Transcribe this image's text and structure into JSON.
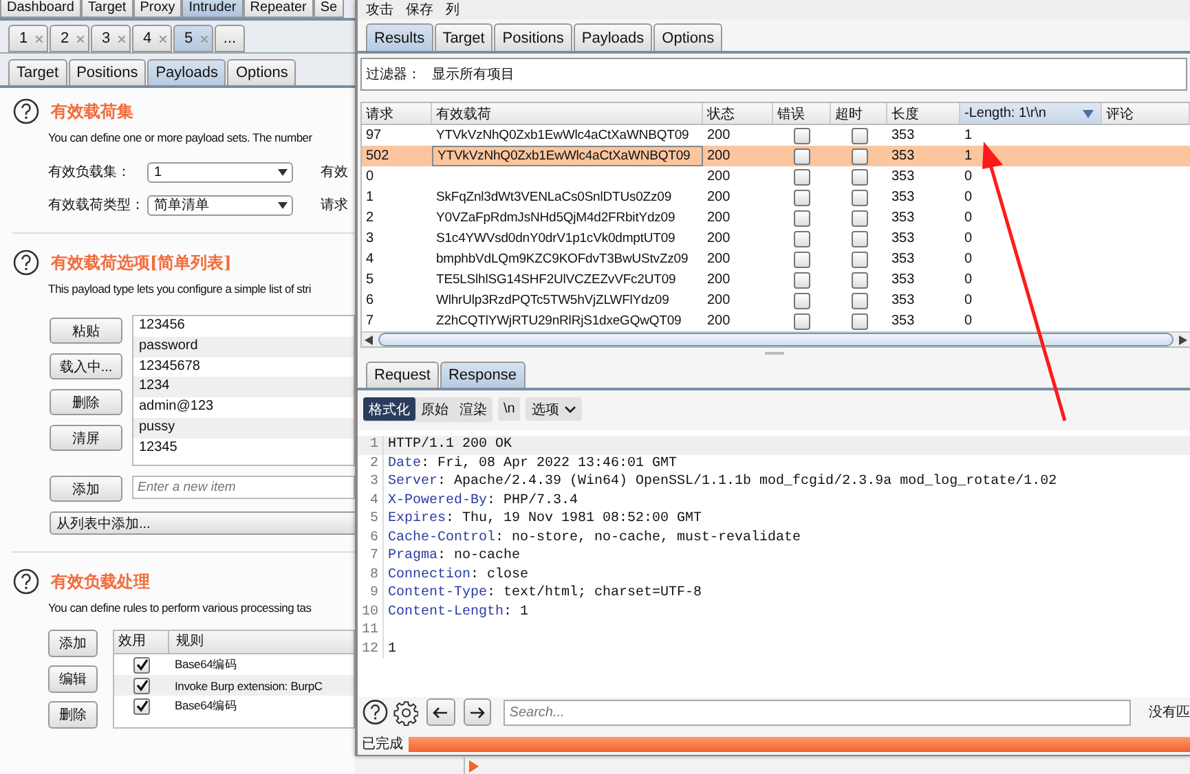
{
  "main_window": {
    "top_tabs": [
      {
        "label": "Dashboard",
        "selected": false
      },
      {
        "label": "Target",
        "selected": false
      },
      {
        "label": "Proxy",
        "selected": false
      },
      {
        "label": "Intruder",
        "selected": true
      },
      {
        "label": "Repeater",
        "selected": false
      },
      {
        "label": "Se",
        "selected": false
      }
    ],
    "attack_tabs": [
      {
        "label": "1",
        "selected": false
      },
      {
        "label": "2",
        "selected": false
      },
      {
        "label": "3",
        "selected": false
      },
      {
        "label": "4",
        "selected": false
      },
      {
        "label": "5",
        "selected": true
      }
    ],
    "more_tabs": "...",
    "sub_tabs": [
      {
        "label": "Target",
        "selected": false
      },
      {
        "label": "Positions",
        "selected": false
      },
      {
        "label": "Payloads",
        "selected": true
      },
      {
        "label": "Options",
        "selected": false
      }
    ],
    "payload_sets": {
      "title": "有效载荷集",
      "description": "You can define one or more payload sets. The number",
      "fields": [
        {
          "label": "有效负载集：",
          "value": "1",
          "side_label": "有效"
        },
        {
          "label": "有效载荷类型：",
          "value": "简单清单",
          "side_label": "请求"
        }
      ]
    },
    "payload_options": {
      "title": "有效载荷选项[简单列表]",
      "description": "This payload type lets you configure a simple list of stri",
      "buttons": [
        "粘贴",
        "载入中...",
        "删除",
        "清屏"
      ],
      "items": [
        "123456",
        "password",
        "12345678",
        "1234",
        "admin@123",
        "pussy",
        "12345"
      ],
      "add_button": "添加",
      "new_item": {
        "placeholder": "Enter a new item"
      },
      "add_from_list": "从列表中添加..."
    },
    "payload_processing": {
      "title": "有效负载处理",
      "description": "You can define rules to perform various processing tas",
      "buttons": [
        "添加",
        "编辑",
        "删除"
      ],
      "columns": [
        "效用",
        "规则"
      ],
      "rules": [
        {
          "enabled": true,
          "rule": "Base64编码"
        },
        {
          "enabled": true,
          "rule": "Invoke Burp extension: BurpC"
        },
        {
          "enabled": true,
          "rule": "Base64编码"
        }
      ]
    }
  },
  "attack_window": {
    "menu": [
      "攻击",
      "保存",
      "列"
    ],
    "tabs": [
      {
        "label": "Results",
        "selected": true
      },
      {
        "label": "Target",
        "selected": false
      },
      {
        "label": "Positions",
        "selected": false
      },
      {
        "label": "Payloads",
        "selected": false
      },
      {
        "label": "Options",
        "selected": false
      }
    ],
    "filter": {
      "label": "过滤器：",
      "value": "显示所有项目"
    },
    "columns": [
      {
        "label": "请求",
        "sorted": false
      },
      {
        "label": "有效载荷",
        "sorted": false
      },
      {
        "label": "状态",
        "sorted": false
      },
      {
        "label": "错误",
        "sorted": false
      },
      {
        "label": "超时",
        "sorted": false
      },
      {
        "label": "长度",
        "sorted": false
      },
      {
        "label": "-Length: 1\\r\\n",
        "sorted": true
      },
      {
        "label": "评论",
        "sorted": false
      }
    ],
    "rows": [
      {
        "request": "97",
        "payload": "YTVkVzNhQ0Zxb1EwWlc4aCtXaWNBQT09",
        "status": "200",
        "error": false,
        "timeout": false,
        "length": "353",
        "match": "1",
        "selected": false
      },
      {
        "request": "502",
        "payload": "YTVkVzNhQ0Zxb1EwWlc4aCtXaWNBQT09",
        "status": "200",
        "error": false,
        "timeout": false,
        "length": "353",
        "match": "1",
        "selected": true
      },
      {
        "request": "0",
        "status": "200",
        "error": false,
        "timeout": false,
        "length": "353",
        "match": "0",
        "selected": false
      },
      {
        "request": "1",
        "payload": "SkFqZnl3dWt3VENLaCs0SnlDTUs0Zz09",
        "status": "200",
        "error": false,
        "timeout": false,
        "length": "353",
        "match": "0",
        "selected": false
      },
      {
        "request": "2",
        "payload": "Y0VZaFpRdmJsNHd5QjM4d2FRbitYdz09",
        "status": "200",
        "error": false,
        "timeout": false,
        "length": "353",
        "match": "0",
        "selected": false
      },
      {
        "request": "3",
        "payload": "S1c4YWVsd0dnY0drV1p1cVk0dmptUT09",
        "status": "200",
        "error": false,
        "timeout": false,
        "length": "353",
        "match": "0",
        "selected": false
      },
      {
        "request": "4",
        "payload": "bmphbVdLQm9KZC9KOFdvT3BwUStvZz09",
        "status": "200",
        "error": false,
        "timeout": false,
        "length": "353",
        "match": "0",
        "selected": false
      },
      {
        "request": "5",
        "payload": "TE5LSlhlSG14SHF2UlVCZEZvVFc2UT09",
        "status": "200",
        "error": false,
        "timeout": false,
        "length": "353",
        "match": "0",
        "selected": false
      },
      {
        "request": "6",
        "payload": "WlhrUlp3RzdPQTc5TW5hVjZLWFlYdz09",
        "status": "200",
        "error": false,
        "timeout": false,
        "length": "353",
        "match": "0",
        "selected": false
      },
      {
        "request": "7",
        "payload": "Z2hCQTlYWjRTU29nRlRjS1dxeGQwQT09",
        "status": "200",
        "error": false,
        "timeout": false,
        "length": "353",
        "match": "0",
        "selected": false
      }
    ],
    "message_tabs": [
      {
        "label": "Request",
        "selected": false
      },
      {
        "label": "Response",
        "selected": true
      }
    ],
    "view_buttons": [
      {
        "label": "格式化",
        "selected": true
      },
      {
        "label": "原始",
        "selected": false
      },
      {
        "label": "渲染",
        "selected": false
      }
    ],
    "newline_button": "\\n",
    "options_button": "选项",
    "response_lines": [
      {
        "number": "1",
        "value": "HTTP/1.1 200 OK",
        "selected": true
      },
      {
        "number": "2",
        "name": "Date",
        "value": ": Fri, 08 Apr 2022 13:46:01 GMT",
        "selected": false
      },
      {
        "number": "3",
        "name": "Server",
        "value": ": Apache/2.4.39 (Win64) OpenSSL/1.1.1b mod_fcgid/2.3.9a mod_log_rotate/1.02",
        "selected": false
      },
      {
        "number": "4",
        "name": "X-Powered-By",
        "value": ": PHP/7.3.4",
        "selected": false
      },
      {
        "number": "5",
        "name": "Expires",
        "value": ": Thu, 19 Nov 1981 08:52:00 GMT",
        "selected": false
      },
      {
        "number": "6",
        "name": "Cache-Control",
        "value": ": no-store, no-cache, must-revalidate",
        "selected": false
      },
      {
        "number": "7",
        "name": "Pragma",
        "value": ": no-cache",
        "selected": false
      },
      {
        "number": "8",
        "name": "Connection",
        "value": ": close",
        "selected": false
      },
      {
        "number": "9",
        "name": "Content-Type",
        "value": ": text/html; charset=UTF-8",
        "selected": false
      },
      {
        "number": "10",
        "name": "Content-Length",
        "value": ": 1",
        "selected": false
      },
      {
        "number": "11",
        "selected": false
      },
      {
        "number": "12",
        "value": "1",
        "selected": false
      }
    ],
    "search": {
      "placeholder": "Search..."
    },
    "match_status": "没有匹",
    "status": "已完成",
    "progress": {
      "level": 1
    }
  }
}
